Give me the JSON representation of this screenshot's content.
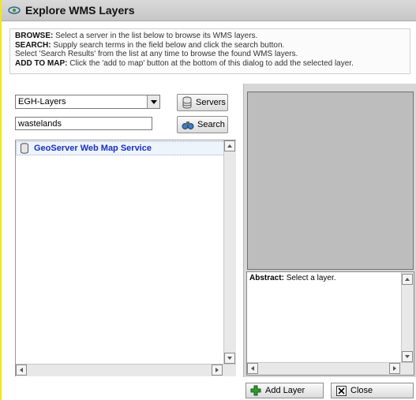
{
  "window": {
    "title": "Explore WMS Layers"
  },
  "instructions": {
    "browse_label": "BROWSE:",
    "browse_text": "Select a server in the list below to browse its WMS layers.",
    "search_label": "SEARCH:",
    "search_text": "Supply search terms in the field below and click the search button.",
    "results_text": "Select 'Search Results' from the list at any time to browse the found WMS layers.",
    "add_label": "ADD TO MAP:",
    "add_text": "Click the 'add to map' button at the bottom of this dialog to add the selected layer."
  },
  "server_select": {
    "value": "EGH-Layers"
  },
  "search": {
    "value": "wastelands"
  },
  "buttons": {
    "servers": "Servers",
    "search": "Search",
    "add_layer": "Add Layer",
    "close": "Close"
  },
  "layer_tree": {
    "items": [
      {
        "label": "GeoServer Web Map Service",
        "icon": "database-icon"
      }
    ]
  },
  "abstract": {
    "label": "Abstract:",
    "text": "Select a layer."
  },
  "colors": {
    "title_bg": "#cccccc",
    "accent_strip": "#f2e900",
    "tree_link": "#1a2fbf",
    "add_icon": "#2e9b2e"
  }
}
